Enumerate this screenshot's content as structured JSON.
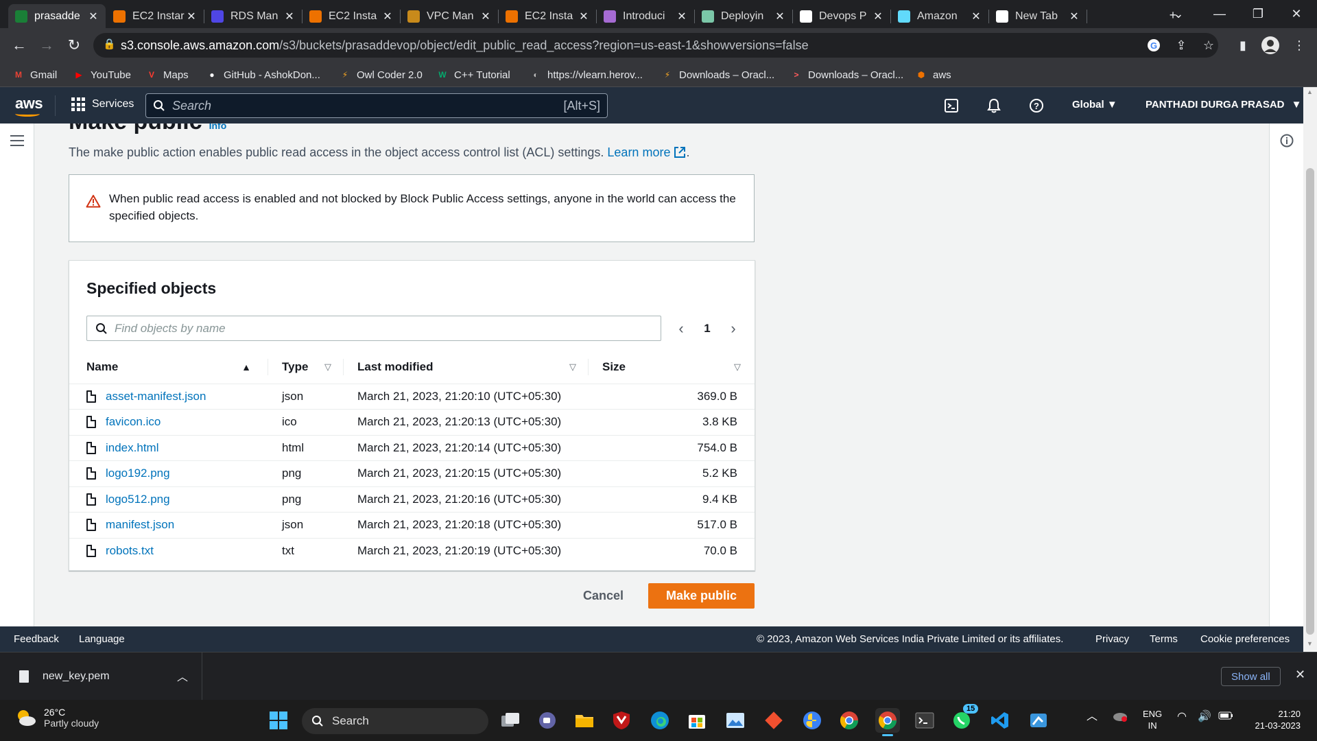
{
  "browser": {
    "tabs": [
      {
        "title": "prasadde",
        "color": "#1a7f37",
        "active": true
      },
      {
        "title": "EC2 Instar",
        "color": "#ed7100"
      },
      {
        "title": "RDS Man",
        "color": "#4f46e5"
      },
      {
        "title": "EC2 Insta",
        "color": "#ed7100"
      },
      {
        "title": "VPC Man",
        "color": "#c88a1b"
      },
      {
        "title": "EC2 Insta",
        "color": "#ed7100"
      },
      {
        "title": "Introduci",
        "color": "#a66bd3"
      },
      {
        "title": "Deployin",
        "color": "#7bc7a8"
      },
      {
        "title": "Devops P",
        "color": "#ffffff"
      },
      {
        "title": "Amazon",
        "color": "#61dafb"
      },
      {
        "title": "New Tab",
        "color": "#ffffff"
      }
    ],
    "new_tab": "+",
    "address": {
      "host": "s3.console.aws.amazon.com",
      "path": "/s3/buckets/prasaddevop/object/edit_public_read_access?region=us-east-1&showversions=false"
    },
    "bookmarks": [
      {
        "label": "Gmail",
        "icon": "M",
        "color": "#ea4335"
      },
      {
        "label": "YouTube",
        "icon": "▶",
        "color": "#ff0000"
      },
      {
        "label": "Maps",
        "icon": "V",
        "color": "#ff3b30"
      },
      {
        "label": "GitHub - AshokDon...",
        "icon": "●",
        "color": "#ffffff"
      },
      {
        "label": "Owl Coder 2.0",
        "icon": "⚡",
        "color": "#f5a623"
      },
      {
        "label": "C++ Tutorial",
        "icon": "W",
        "color": "#04aa6d"
      },
      {
        "label": "https://vlearn.herov...",
        "icon": "◐",
        "color": "#bdbdbd"
      },
      {
        "label": "Downloads – Oracl...",
        "icon": "⚡",
        "color": "#f5a623"
      },
      {
        "label": "Downloads – Oracl...",
        "icon": ">",
        "color": "#ff5c5c"
      },
      {
        "label": "aws",
        "icon": "⬢",
        "color": "#ed7100"
      }
    ]
  },
  "aws_header": {
    "logo": "aws",
    "services": "Services",
    "search_placeholder": "Search",
    "search_shortcut": "[Alt+S]",
    "region": "Global",
    "user": "PANTHADI DURGA PRASAD"
  },
  "page": {
    "title": "Make public",
    "title_info": "Info",
    "description": "The make public action enables public read access in the object access control list (ACL) settings.",
    "learn_more": "Learn more",
    "description_end": ".",
    "warning": "When public read access is enabled and not blocked by Block Public Access settings, anyone in the world can access the specified objects.",
    "objects_panel": {
      "title": "Specified objects",
      "find_placeholder": "Find objects by name",
      "page_number": "1",
      "columns": [
        "Name",
        "Type",
        "Last modified",
        "Size"
      ],
      "rows": [
        {
          "name": "asset-manifest.json",
          "type": "json",
          "modified": "March 21, 2023, 21:20:10 (UTC+05:30)",
          "size": "369.0 B"
        },
        {
          "name": "favicon.ico",
          "type": "ico",
          "modified": "March 21, 2023, 21:20:13 (UTC+05:30)",
          "size": "3.8 KB"
        },
        {
          "name": "index.html",
          "type": "html",
          "modified": "March 21, 2023, 21:20:14 (UTC+05:30)",
          "size": "754.0 B"
        },
        {
          "name": "logo192.png",
          "type": "png",
          "modified": "March 21, 2023, 21:20:15 (UTC+05:30)",
          "size": "5.2 KB"
        },
        {
          "name": "logo512.png",
          "type": "png",
          "modified": "March 21, 2023, 21:20:16 (UTC+05:30)",
          "size": "9.4 KB"
        },
        {
          "name": "manifest.json",
          "type": "json",
          "modified": "March 21, 2023, 21:20:18 (UTC+05:30)",
          "size": "517.0 B"
        },
        {
          "name": "robots.txt",
          "type": "txt",
          "modified": "March 21, 2023, 21:20:19 (UTC+05:30)",
          "size": "70.0 B"
        }
      ]
    },
    "cancel_label": "Cancel",
    "make_public_label": "Make public"
  },
  "aws_footer": {
    "feedback": "Feedback",
    "language": "Language",
    "copyright": "© 2023, Amazon Web Services India Private Limited or its affiliates.",
    "privacy": "Privacy",
    "terms": "Terms",
    "cookies": "Cookie preferences"
  },
  "downloads": {
    "file": "new_key.pem",
    "show_all": "Show all"
  },
  "taskbar": {
    "temperature": "26°C",
    "weather": "Partly cloudy",
    "search": "Search",
    "whatsapp_badge": "15",
    "lang_top": "ENG",
    "lang_bottom": "IN",
    "time": "21:20",
    "date": "21-03-2023"
  }
}
